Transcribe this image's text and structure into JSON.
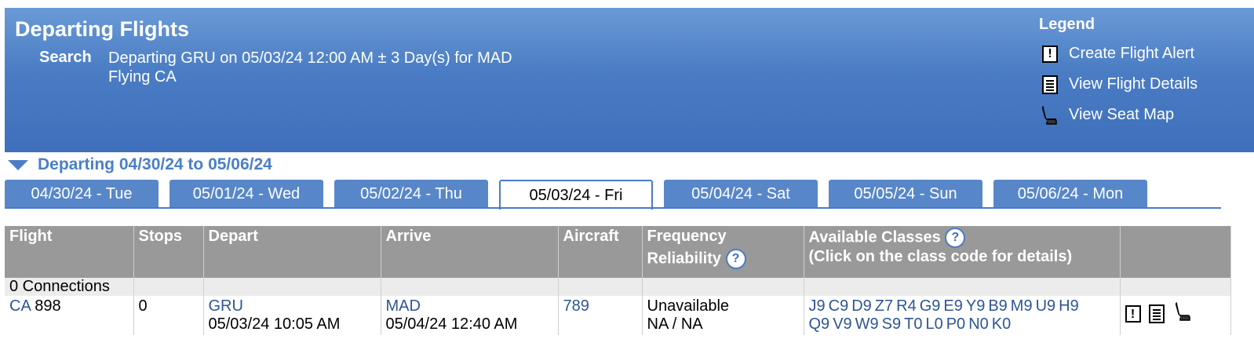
{
  "header": {
    "title": "Departing Flights",
    "search_label": "Search",
    "search_line1": "Departing GRU on 05/03/24 12:00 AM ± 3 Day(s) for MAD",
    "search_line2": "Flying CA"
  },
  "legend": {
    "title": "Legend",
    "items": [
      {
        "icon": "alert-icon",
        "label": "Create Flight Alert"
      },
      {
        "icon": "details-icon",
        "label": "View Flight Details"
      },
      {
        "icon": "seat-icon",
        "label": "View Seat Map"
      }
    ]
  },
  "range_label": "Departing 04/30/24 to 05/06/24",
  "tabs": [
    {
      "label": "04/30/24 - Tue"
    },
    {
      "label": "05/01/24 - Wed"
    },
    {
      "label": "05/02/24 - Thu"
    },
    {
      "label": "05/03/24 - Fri",
      "active": true
    },
    {
      "label": "05/04/24 - Sat"
    },
    {
      "label": "05/05/24 - Sun"
    },
    {
      "label": "05/06/24 - Mon"
    }
  ],
  "table": {
    "columns": {
      "flight": "Flight",
      "stops": "Stops",
      "depart": "Depart",
      "arrive": "Arrive",
      "aircraft": "Aircraft",
      "freq1": "Frequency",
      "freq2": "Reliability",
      "classes1": "Available Classes",
      "classes2": "(Click on the class code for details)"
    },
    "group_label": "0 Connections",
    "row": {
      "airline": "CA",
      "number": "898",
      "stops": "0",
      "depart_code": "GRU",
      "depart_time": "05/03/24 10:05 AM",
      "arrive_code": "MAD",
      "arrive_time": "05/04/24 12:40 AM",
      "aircraft": "789",
      "frequency": "Unavailable",
      "reliability": "NA / NA",
      "classes_line1": [
        "J9",
        "C9",
        "D9",
        "Z7",
        "R4",
        "G9",
        "E9",
        "Y9",
        "B9",
        "M9",
        "U9",
        "H9"
      ],
      "classes_line2": [
        "Q9",
        "V9",
        "W9",
        "S9",
        "T0",
        "L0",
        "P0",
        "N0",
        "K0"
      ]
    }
  },
  "colors": {
    "header_bg": "#4a7cc4",
    "link": "#2e5596",
    "table_header_bg": "#999999"
  }
}
